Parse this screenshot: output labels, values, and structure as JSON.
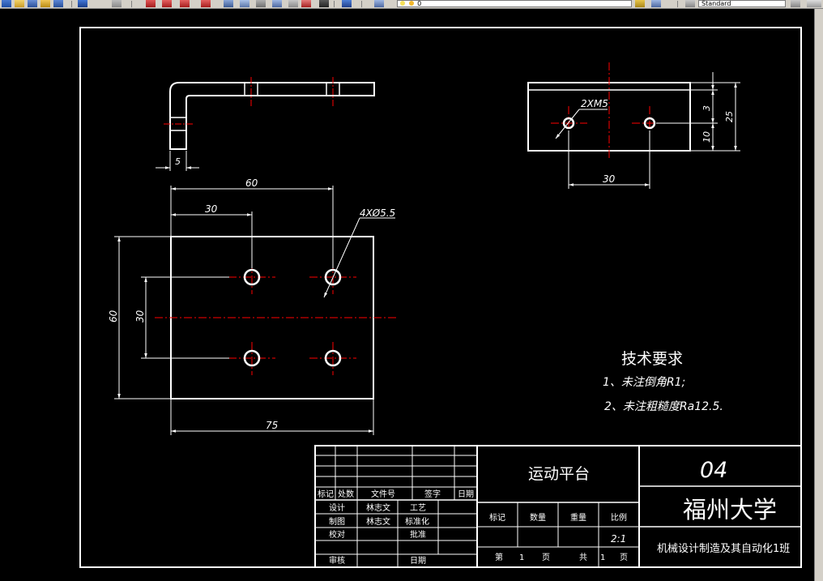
{
  "toolbar": {
    "text_style": "Standard",
    "layer_value": "0",
    "colors": {
      "toolbar_bg": "#d4d0c8",
      "combo_bg": "#ffffff"
    }
  },
  "drawing": {
    "colors": {
      "background": "#000000",
      "lines": "#ffffff",
      "centerlines": "#ff0000",
      "combo_text": "#000000"
    },
    "dims": {
      "top_thickness": "5",
      "plan_width_60": "60",
      "plan_30": "30",
      "hole_callout": "4XØ5.5",
      "plan_height_60": "60",
      "plan_hole_spacing_30": "30",
      "plan_width_75": "75",
      "side_thread": "2XM5",
      "side_spacing_30": "30",
      "side_3": "3",
      "side_10": "10",
      "side_25": "25"
    },
    "notes": {
      "title": "技术要求",
      "line1": "1、未注倒角R1;",
      "line2": "2、未注粗糙度Ra12.5."
    },
    "title_block": {
      "part_name": "运动平台",
      "drawing_no": "04",
      "school": "福州大学",
      "class_name": "机械设计制造及其自动化1班",
      "rev_headers": [
        "标记",
        "处数",
        "文件号",
        "签字",
        "日期"
      ],
      "design_label": "设计",
      "designer": "林志文",
      "process_label": "工艺",
      "drafting_label": "制图",
      "drafter": "林志文",
      "standard_label": "标准化",
      "check_label": "校对",
      "approve_label": "批准",
      "review_label": "审核",
      "date_label": "日期",
      "mark_label": "标记",
      "qty_label": "数量",
      "weight_label": "重量",
      "scale_label": "比例",
      "scale_value": "2:1",
      "sheet_prefix": "第",
      "sheet_no": "1",
      "sheet_unit": "页",
      "total_prefix": "共",
      "total_no": "1",
      "total_unit": "页"
    }
  }
}
